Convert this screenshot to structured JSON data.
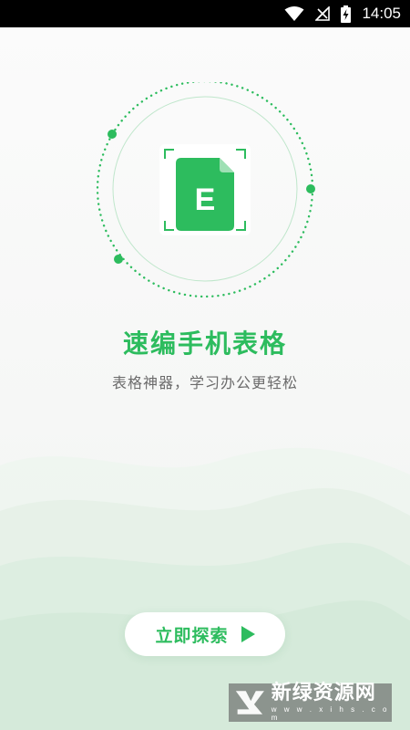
{
  "status_bar": {
    "time": "14:05",
    "icons": [
      "wifi-icon",
      "signal-off-icon",
      "battery-charging-icon"
    ]
  },
  "splash": {
    "title": "速编手机表格",
    "subtitle": "表格神器，学习办公更轻松",
    "logo_letter": "E",
    "cta_label": "立即探索"
  },
  "watermark": {
    "brand_text": "新绿资源网",
    "domain_text": "w w w . x i h s . c o m"
  },
  "colors": {
    "accent": "#2dbc5e",
    "subtitle_text": "#6b6b6b",
    "status_bar_bg": "#000000"
  }
}
